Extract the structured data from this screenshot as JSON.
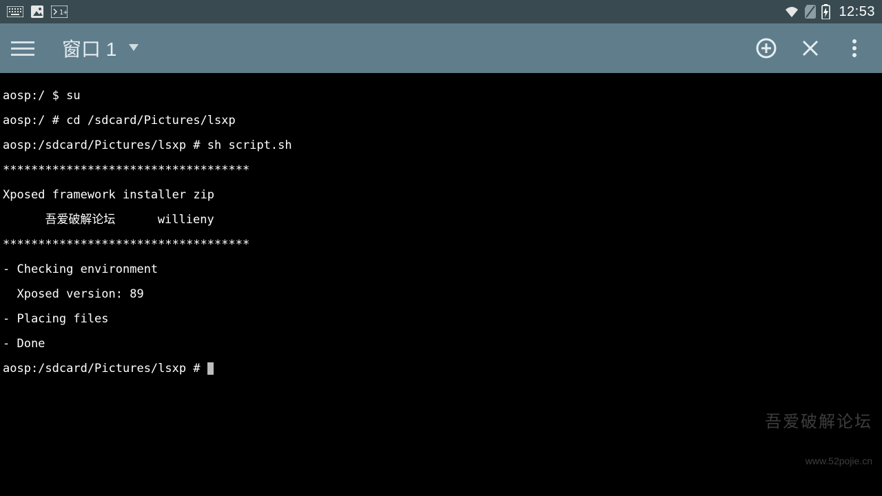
{
  "statusbar": {
    "clock": "12:53"
  },
  "appbar": {
    "window_title": "窗口 1"
  },
  "terminal": {
    "lines": [
      "aosp:/ $ su",
      "aosp:/ # cd /sdcard/Pictures/lsxp",
      "aosp:/sdcard/Pictures/lsxp # sh script.sh",
      "***********************************",
      "Xposed framework installer zip",
      "      吾爱破解论坛      willieny",
      "***********************************",
      "- Checking environment",
      "  Xposed version: 89",
      "- Placing files",
      "- Done",
      "aosp:/sdcard/Pictures/lsxp # "
    ]
  },
  "watermark": {
    "line1": "吾爱破解论坛",
    "line2": "www.52pojie.cn"
  }
}
